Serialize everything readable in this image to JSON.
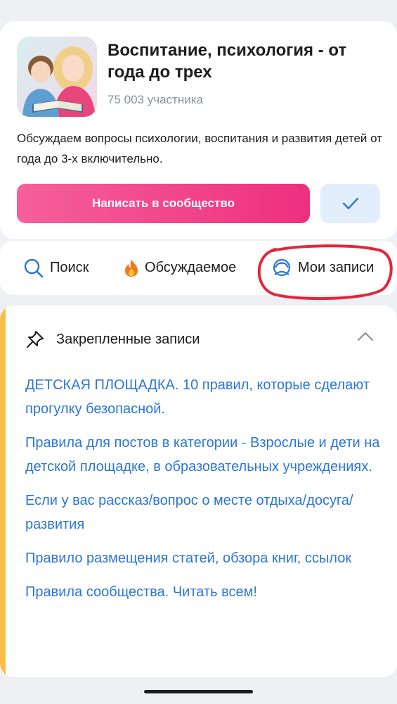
{
  "group": {
    "title": "Воспитание, психология - от года до трех",
    "members": "75 003 участника",
    "description": "Обсуждаем вопросы психологии, воспитания и развития детей от года до 3-х включительно.",
    "avatar_icon": "group-avatar-mother-child-reading"
  },
  "actions": {
    "write_label": "Написать в сообщество",
    "subscribed_icon": "check-icon",
    "accent_color": "#ee2f7f"
  },
  "tabs": [
    {
      "label": "Поиск",
      "icon": "search-icon"
    },
    {
      "label": "Обсуждаемое",
      "icon": "fire-icon"
    },
    {
      "label": "Мои записи",
      "icon": "user-icon"
    }
  ],
  "pinned": {
    "title": "Закрепленные записи",
    "icon": "pin-icon",
    "items": [
      "ДЕТСКАЯ ПЛОЩАДКА. 10 правил, которые сделают прогулку безопасной.",
      "Правила для постов в категории - Взрослые и дети на детской площадке, в образовательных учреждениях.",
      "Если у вас рассказ/вопрос о месте отдыха/досуга/развития",
      "Правило размещения статей, обзора книг, ссылок",
      "Правила сообщества. Читать всем!"
    ],
    "link_color": "#2c76d4",
    "accent_color": "#fbbd4a"
  }
}
